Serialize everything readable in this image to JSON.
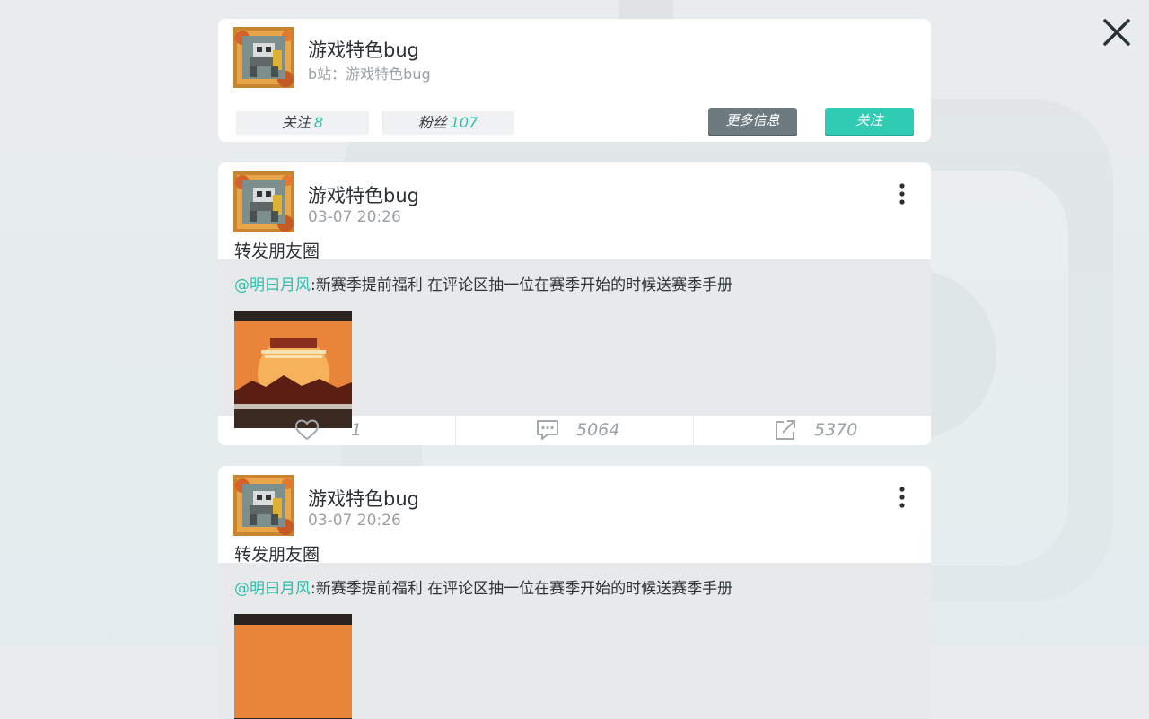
{
  "close": {
    "icon": "close-icon"
  },
  "profile": {
    "name": "游戏特色bug",
    "subtitle": "b站：游戏特色bug",
    "follow_label": "关注",
    "follow_count": "8",
    "fans_label": "粉丝",
    "fans_count": "107",
    "more_info_button": "更多信息",
    "follow_button": "关注"
  },
  "posts": [
    {
      "author": "游戏特色bug",
      "time": "03-07 20:26",
      "text": "转发朋友圈",
      "repost": {
        "mention": "@明曰月风",
        "content": ":新赛季提前福利  在评论区抽一位在赛季开始的时候送赛季手册"
      },
      "likes": "1",
      "comments": "5064",
      "shares": "5370"
    },
    {
      "author": "游戏特色bug",
      "time": "03-07 20:26",
      "text": "转发朋友圈",
      "repost": {
        "mention": "@明曰月风",
        "content": ":新赛季提前福利  在评论区抽一位在赛季开始的时候送赛季手册"
      }
    }
  ],
  "colors": {
    "accent": "#2fcbb2",
    "more_button": "#6d7b81",
    "muted": "#9aa2a7"
  }
}
